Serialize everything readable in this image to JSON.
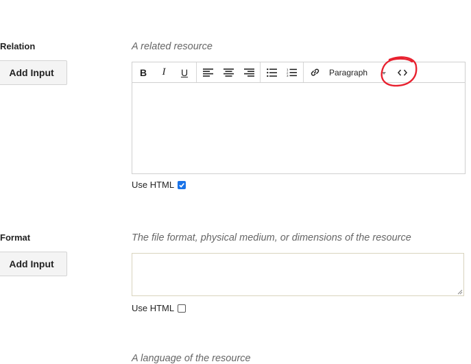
{
  "relation": {
    "label": "Relation",
    "add_button": "Add Input",
    "description": "A related resource",
    "use_html_label": "Use HTML",
    "use_html_checked": true,
    "toolbar": {
      "bold": "B",
      "italic": "I",
      "underline": "U",
      "block_format": "Paragraph"
    }
  },
  "format": {
    "label": "Format",
    "add_button": "Add Input",
    "description": "The file format, physical medium, or dimensions of the resource",
    "use_html_label": "Use HTML",
    "use_html_checked": false
  },
  "next_field": {
    "description": "A language of the resource"
  },
  "colors": {
    "annotation": "#e8212f",
    "checkbox_accent": "#1a73e8"
  }
}
